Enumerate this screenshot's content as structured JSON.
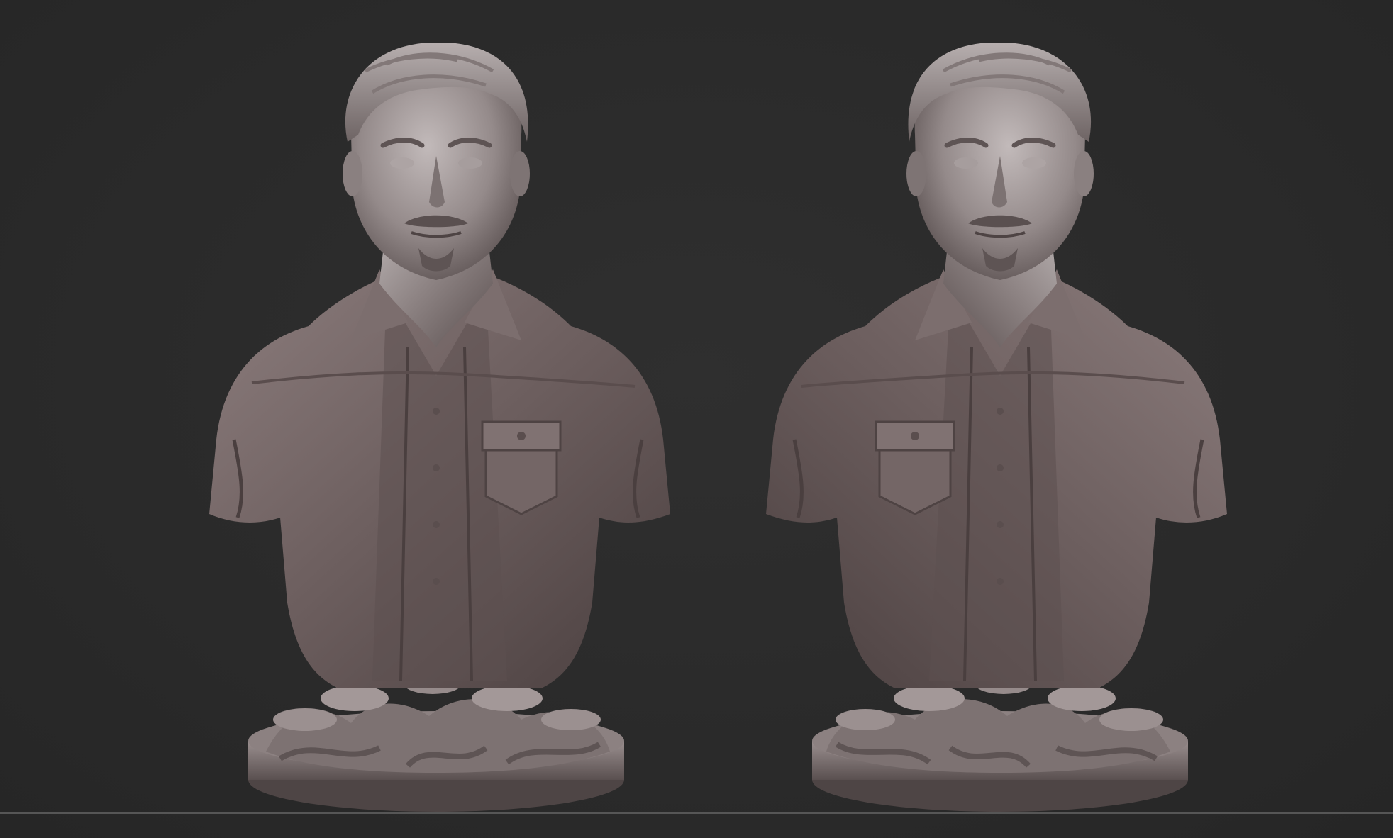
{
  "scene": {
    "background_color": "#2b2b2b",
    "material_color": "#6f6262",
    "objects": [
      {
        "name": "bust-front-view",
        "icon": "sculpt-bust"
      },
      {
        "name": "bust-three-quarter-view",
        "icon": "sculpt-bust"
      }
    ]
  }
}
